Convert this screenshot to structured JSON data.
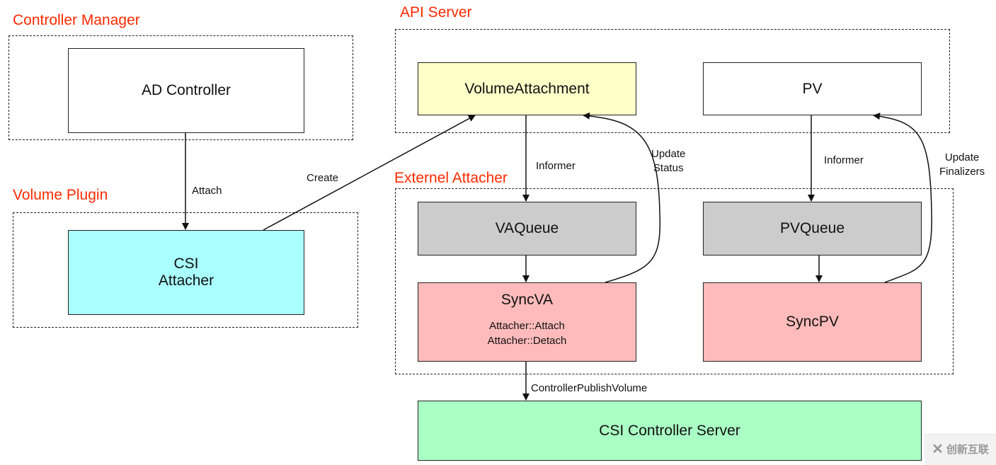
{
  "groups": {
    "controller_manager": "Controller Manager",
    "volume_plugin": "Volume Plugin",
    "api_server": "API Server",
    "external_attacher": "Externel Attacher"
  },
  "nodes": {
    "ad_controller": "AD Controller",
    "csi_attacher_1": "CSI",
    "csi_attacher_2": "Attacher",
    "volume_attachment": "VolumeAttachment",
    "pv": "PV",
    "va_queue": "VAQueue",
    "pv_queue": "PVQueue",
    "sync_va": "SyncVA",
    "sync_va_attach": "Attacher::Attach",
    "sync_va_detach": "Attacher::Detach",
    "sync_pv": "SyncPV",
    "csi_controller_server": "CSI Controller Server"
  },
  "edges": {
    "attach": "Attach",
    "create": "Create",
    "informer_va": "Informer",
    "update_status_1": "Update",
    "update_status_2": "Status",
    "informer_pv": "Informer",
    "update_finalizers_1": "Update",
    "update_finalizers_2": "Finalizers",
    "controller_publish_volume": "ControllerPublishVolume"
  },
  "colors": {
    "group_label": "#ff2a00",
    "volume_attachment": "#ffffc8",
    "csi_attacher": "#aaffff",
    "queue": "#cccccc",
    "sync": "#ffbbbb",
    "csi_controller_server": "#aaffc4"
  },
  "watermark": "创新互联"
}
